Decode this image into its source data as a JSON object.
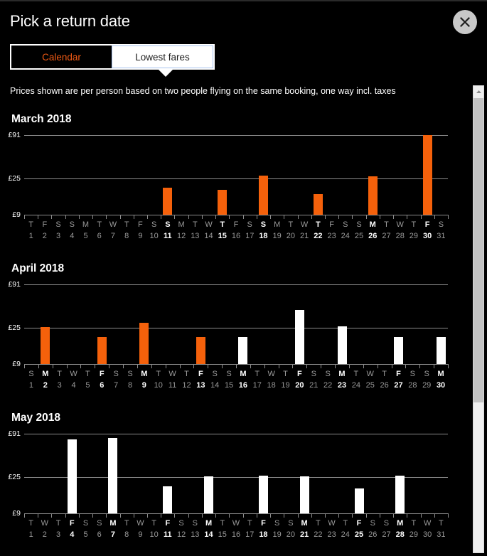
{
  "header": {
    "title": "Pick a return date",
    "close_icon": "close-x-icon"
  },
  "tabs": [
    {
      "label": "Calendar",
      "active": false
    },
    {
      "label": "Lowest fares",
      "active": true
    }
  ],
  "subtitle": "Prices shown are per person based on two people flying on the same booking, one way incl. taxes",
  "scrollbar": {
    "up_arrow_icon": "chevron-up-icon",
    "thumb_position_pct": 0,
    "thumb_size_pct": 65
  },
  "colors": {
    "background": "#000000",
    "accent_orange": "#f5610b",
    "bar_white": "#ffffff",
    "gridline": "#8c8c8c",
    "tab_active_border": "#a9c4ef",
    "close_button": "#c8c8c8"
  },
  "chart_data": [
    {
      "type": "bar",
      "title": "March 2018",
      "xlabel": "",
      "ylabel": "",
      "ylim": [
        9,
        91
      ],
      "ytick_labels": [
        "£9",
        "£25",
        "£91"
      ],
      "ytick_values": [
        9,
        25,
        91
      ],
      "grid": true,
      "legend": "none",
      "categories": [
        "1",
        "2",
        "3",
        "4",
        "5",
        "6",
        "7",
        "8",
        "9",
        "10",
        "11",
        "12",
        "13",
        "14",
        "15",
        "16",
        "17",
        "18",
        "19",
        "20",
        "21",
        "22",
        "23",
        "24",
        "25",
        "26",
        "27",
        "28",
        "29",
        "30",
        "31"
      ],
      "weekdays": [
        "T",
        "F",
        "S",
        "S",
        "M",
        "T",
        "W",
        "T",
        "F",
        "S",
        "S",
        "M",
        "T",
        "W",
        "T",
        "F",
        "S",
        "S",
        "M",
        "T",
        "W",
        "T",
        "F",
        "S",
        "S",
        "M",
        "T",
        "W",
        "T",
        "F",
        "S"
      ],
      "values": [
        null,
        null,
        null,
        null,
        null,
        null,
        null,
        null,
        null,
        null,
        21,
        null,
        null,
        null,
        20,
        null,
        null,
        29,
        null,
        null,
        null,
        18,
        null,
        null,
        null,
        28,
        null,
        null,
        null,
        91,
        null
      ],
      "bar_colors": [
        null,
        null,
        null,
        null,
        null,
        null,
        null,
        null,
        null,
        null,
        "orange",
        null,
        null,
        null,
        "orange",
        null,
        null,
        "orange",
        null,
        null,
        null,
        "orange",
        null,
        null,
        null,
        "orange",
        null,
        null,
        null,
        "orange",
        null
      ]
    },
    {
      "type": "bar",
      "title": "April 2018",
      "xlabel": "",
      "ylabel": "",
      "ylim": [
        9,
        91
      ],
      "ytick_labels": [
        "£9",
        "£25",
        "£91"
      ],
      "ytick_values": [
        9,
        25,
        91
      ],
      "grid": true,
      "legend": "none",
      "categories": [
        "1",
        "2",
        "3",
        "4",
        "5",
        "6",
        "7",
        "8",
        "9",
        "10",
        "11",
        "12",
        "13",
        "14",
        "15",
        "16",
        "17",
        "18",
        "19",
        "20",
        "21",
        "22",
        "23",
        "24",
        "25",
        "26",
        "27",
        "28",
        "29",
        "30"
      ],
      "weekdays": [
        "S",
        "M",
        "T",
        "W",
        "T",
        "F",
        "S",
        "S",
        "M",
        "T",
        "W",
        "T",
        "F",
        "S",
        "S",
        "M",
        "T",
        "W",
        "T",
        "F",
        "S",
        "S",
        "M",
        "T",
        "W",
        "T",
        "F",
        "S",
        "S",
        "M"
      ],
      "values": [
        null,
        26,
        null,
        null,
        null,
        21,
        null,
        null,
        33,
        null,
        null,
        null,
        21,
        null,
        null,
        21,
        null,
        null,
        null,
        52,
        null,
        null,
        27,
        null,
        null,
        null,
        21,
        null,
        null,
        21
      ],
      "bar_colors": [
        null,
        "orange",
        null,
        null,
        null,
        "orange",
        null,
        null,
        "orange",
        null,
        null,
        null,
        "orange",
        null,
        null,
        "white",
        null,
        null,
        null,
        "white",
        null,
        null,
        "white",
        null,
        null,
        null,
        "white",
        null,
        null,
        "white"
      ]
    },
    {
      "type": "bar",
      "title": "May 2018",
      "xlabel": "",
      "ylabel": "",
      "ylim": [
        9,
        91
      ],
      "ytick_labels": [
        "£9",
        "£25",
        "£91"
      ],
      "ytick_values": [
        9,
        25,
        91
      ],
      "grid": true,
      "legend": "none",
      "categories": [
        "1",
        "2",
        "3",
        "4",
        "5",
        "6",
        "7",
        "8",
        "9",
        "10",
        "11",
        "12",
        "13",
        "14",
        "15",
        "16",
        "17",
        "18",
        "19",
        "20",
        "21",
        "22",
        "23",
        "24",
        "25",
        "26",
        "27",
        "28",
        "29",
        "30",
        "31"
      ],
      "weekdays": [
        "T",
        "W",
        "T",
        "F",
        "S",
        "S",
        "M",
        "T",
        "W",
        "T",
        "F",
        "S",
        "S",
        "M",
        "T",
        "W",
        "T",
        "F",
        "S",
        "S",
        "M",
        "T",
        "W",
        "T",
        "F",
        "S",
        "S",
        "M",
        "T",
        "W",
        "T"
      ],
      "values": [
        null,
        null,
        null,
        82,
        null,
        null,
        84,
        null,
        null,
        null,
        21,
        null,
        null,
        26,
        null,
        null,
        null,
        27,
        null,
        null,
        26,
        null,
        null,
        null,
        20,
        null,
        null,
        27,
        null,
        null,
        null
      ],
      "bar_colors": [
        null,
        null,
        null,
        "white",
        null,
        null,
        "white",
        null,
        null,
        null,
        "white",
        null,
        null,
        "white",
        null,
        null,
        null,
        "white",
        null,
        null,
        "white",
        null,
        null,
        null,
        "white",
        null,
        null,
        "white",
        null,
        null,
        null
      ]
    }
  ]
}
